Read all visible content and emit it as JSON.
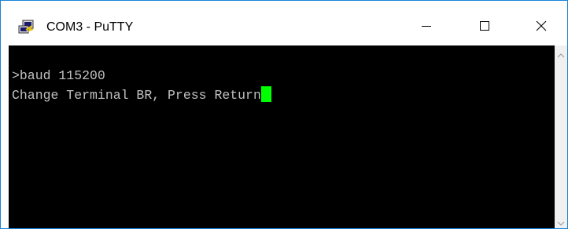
{
  "window": {
    "title": "COM3 - PuTTY",
    "accent_color": "#1883d7"
  },
  "title_controls": {
    "minimize_icon": "minimize-icon",
    "maximize_icon": "maximize-icon",
    "close_icon": "close-icon"
  },
  "terminal": {
    "background_color": "#000000",
    "text_color": "#c0c0c0",
    "cursor_color": "#00ff00",
    "lines": [
      ">baud 115200",
      "Change Terminal BR, Press Return"
    ]
  },
  "scrollbar": {
    "up_icon": "chevron-up-icon",
    "down_icon": "chevron-down-icon"
  }
}
